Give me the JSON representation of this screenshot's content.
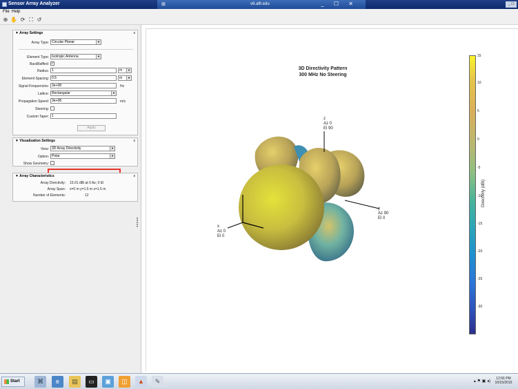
{
  "window": {
    "title": "Sensor Array Analyzer",
    "remote_host": "v6.alfr.edu",
    "remote_controls": "_ ☐ ✕",
    "right_controls": "_ □"
  },
  "menu": {
    "file": "File",
    "help": "Help"
  },
  "toolbar": {
    "icons": [
      "zoom-in-icon",
      "pan-icon",
      "rotate-icon",
      "fit-icon",
      "reset-icon"
    ]
  },
  "array_settings": {
    "header": "▼ Array Settings",
    "array_type_label": "Array Type:",
    "array_type_value": "Circular Planar",
    "element_type_label": "Element Type:",
    "element_type_value": "Isotropic Antenna",
    "backbaffled_label": "BackBaffled:",
    "backbaffled_checked": true,
    "radius_label": "Radius:",
    "radius_value": "1",
    "radius_unit": "m",
    "element_spacing_label": "Element Spacing:",
    "element_spacing_value": "0.5",
    "element_spacing_unit": "m",
    "signal_freq_label": "Signal Frequencies:",
    "signal_freq_value": "3e+08",
    "signal_freq_unit": "Hz",
    "lattice_label": "Lattice:",
    "lattice_value": "Rectangular",
    "prop_speed_label": "Propagation Speed:",
    "prop_speed_value": "3e+08",
    "prop_speed_unit": "m/s",
    "steering_label": "Steering:",
    "steering_checked": false,
    "custom_taper_label": "Custom Taper:",
    "custom_taper_value": "1",
    "apply_label": "Apply"
  },
  "visualization_settings": {
    "header": "▼ Visualization Settings",
    "view_label": "View:",
    "view_value": "3D Array Directivity",
    "option_label": "Option:",
    "option_value": "Polar",
    "show_geometry_label": "Show Geometry:",
    "show_geometry_checked": false
  },
  "array_characteristics": {
    "header": "▼ Array Characteristics",
    "rows": [
      {
        "label": "Array Directivity:",
        "value": "15.01 dBi at 0 Az; 0 El"
      },
      {
        "label": "Array Span:",
        "value": "x=0 m y=1.5 m z=1.5 m"
      },
      {
        "label": "Number of Elements:",
        "value": "12"
      }
    ]
  },
  "plot": {
    "title_line1": "3D Directivity Pattern",
    "title_line2": "300 MHz No Steering",
    "axis_z": "z\nAz 0\nEl 90",
    "axis_y": "y\nAz 90\nEl 0",
    "axis_x": "x\nAz 0\nEl 0",
    "colorbar_label": "Directivity (dBi)",
    "colorbar_ticks": [
      "15",
      "10",
      "5",
      "0",
      "-5",
      "-10",
      "-15",
      "-20",
      "-25",
      "-30"
    ],
    "colors": {
      "high": "#f9f52a",
      "mid": "#49b49a",
      "low": "#2c2e8a"
    }
  },
  "taskbar": {
    "start_label": "Start",
    "clock_time": "12:56 PM",
    "clock_date": "10/15/2015"
  }
}
